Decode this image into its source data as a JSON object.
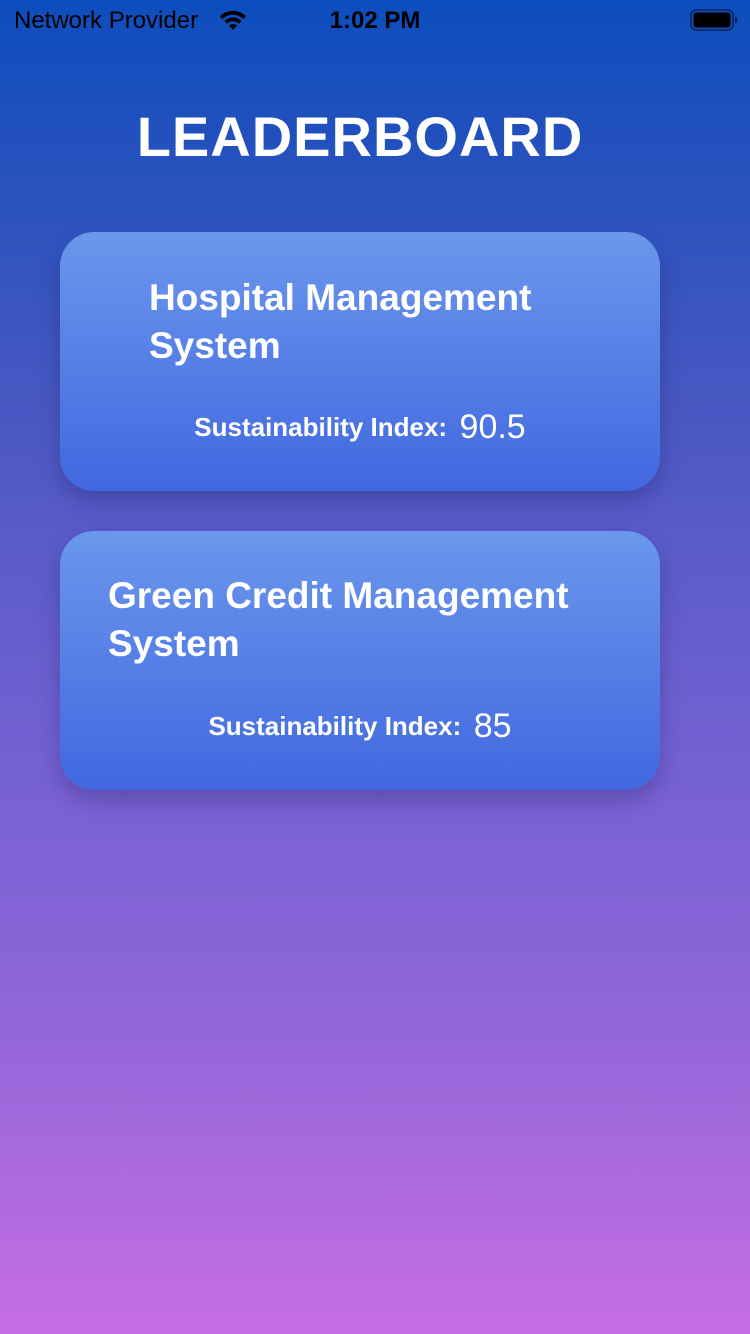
{
  "status_bar": {
    "carrier": "Network Provider",
    "time": "1:02 PM"
  },
  "page": {
    "title": "LEADERBOARD"
  },
  "leaderboard": {
    "items": [
      {
        "name": "Hospital Management System",
        "index_label": "Sustainability Index:",
        "index_value": "90.5"
      },
      {
        "name": "Green Credit Management System",
        "index_label": "Sustainability Index:",
        "index_value": "85"
      }
    ]
  },
  "icons": {
    "wifi": "wifi-icon",
    "battery": "battery-icon"
  },
  "colors": {
    "gradient_top": "#0d4dbd",
    "gradient_bottom": "#c66ee3",
    "card_top": "#6b97ec",
    "card_bottom": "#4168e0",
    "text": "#ffffff"
  }
}
